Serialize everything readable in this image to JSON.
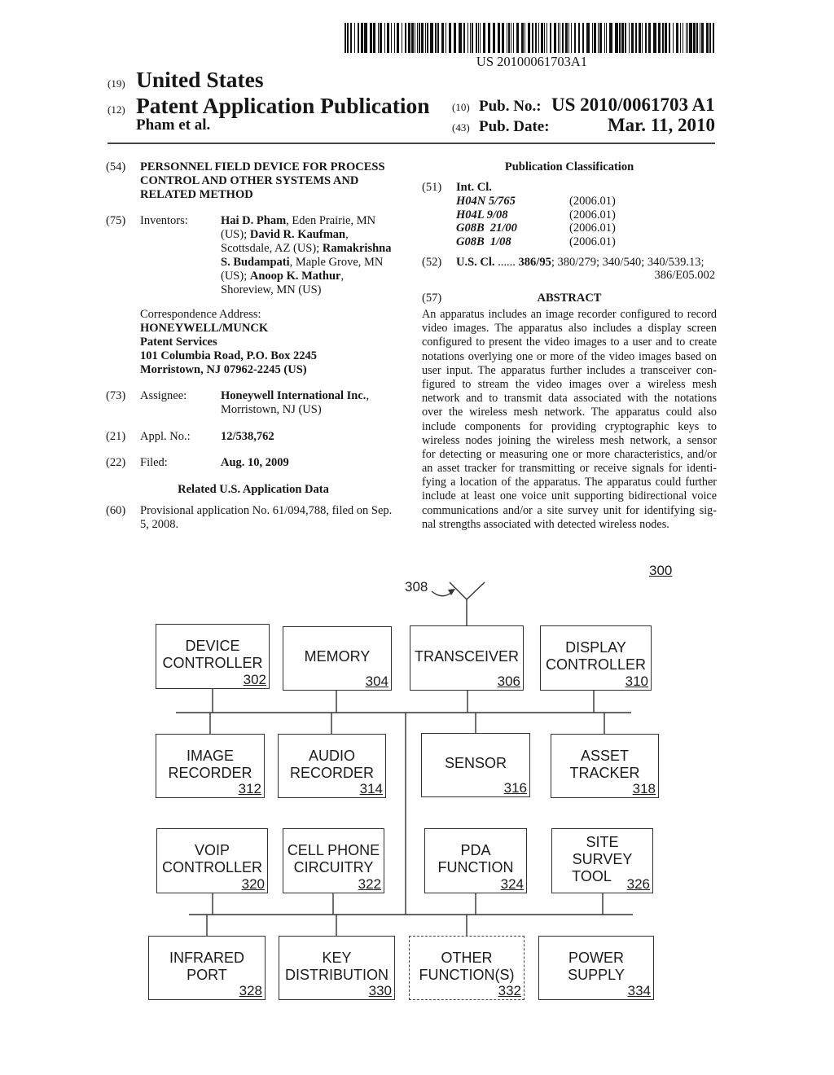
{
  "barcode": {
    "text": "US 20100061703A1"
  },
  "header": {
    "country_code": "(19)",
    "country": "United States",
    "type_code": "(12)",
    "type": "Patent Application Publication",
    "authors": "Pham et al.",
    "pub_no_code": "(10)",
    "pub_no_label": "Pub. No.:",
    "pub_no": "US 2010/0061703 A1",
    "pub_date_code": "(43)",
    "pub_date_label": "Pub. Date:",
    "pub_date": "Mar. 11, 2010"
  },
  "left": {
    "title": {
      "code": "(54)",
      "lines": [
        "PERSONNEL FIELD DEVICE FOR PROCESS",
        "CONTROL AND OTHER SYSTEMS AND",
        "RELATED METHOD"
      ]
    },
    "inventors": {
      "code": "(75)",
      "label": "Inventors:",
      "lines": [
        [
          {
            "text": "Hai D. Pham",
            "bold": true
          },
          {
            "text": ", Eden Prairie, MN"
          }
        ],
        [
          {
            "text": "(US); "
          },
          {
            "text": "David R. Kaufman",
            "bold": true
          },
          {
            "text": ","
          }
        ],
        [
          {
            "text": "Scottsdale, AZ (US); "
          },
          {
            "text": "Ramakrishna",
            "bold": true
          }
        ],
        [
          {
            "text": "S. Budampati",
            "bold": true
          },
          {
            "text": ", Maple Grove, MN"
          }
        ],
        [
          {
            "text": "(US); "
          },
          {
            "text": "Anoop K. Mathur",
            "bold": true
          },
          {
            "text": ","
          }
        ],
        [
          {
            "text": "Shoreview, MN (US)"
          }
        ]
      ]
    },
    "correspondence": {
      "label": "Correspondence Address:",
      "lines": [
        "HONEYWELL/MUNCK",
        "Patent Services",
        "101 Columbia Road, P.O. Box 2245",
        "Morristown, NJ 07962-2245 (US)"
      ]
    },
    "assignee": {
      "code": "(73)",
      "label": "Assignee:",
      "name": "Honeywell International Inc.",
      "name_suffix": ",",
      "location": "Morristown, NJ (US)"
    },
    "appl_no": {
      "code": "(21)",
      "label": "Appl. No.:",
      "value": "12/538,762"
    },
    "filed": {
      "code": "(22)",
      "label": "Filed:",
      "value": "Aug. 10, 2009"
    },
    "related_heading": "Related U.S. Application Data",
    "provisional": {
      "code": "(60)",
      "lines": [
        "Provisional application No. 61/094,788, filed on Sep.",
        "5, 2008."
      ]
    }
  },
  "right": {
    "classification_heading": "Publication Classification",
    "int_cl": {
      "code": "(51)",
      "label": "Int. Cl.",
      "entries": [
        {
          "class": "H04N 5/765",
          "version": "(2006.01)"
        },
        {
          "class": "H04L 9/08",
          "version": "(2006.01)"
        },
        {
          "class": "G08B  21/00",
          "version": "(2006.01)"
        },
        {
          "class": "G08B  1/08",
          "version": "(2006.01)"
        }
      ]
    },
    "us_cl": {
      "code": "(52)",
      "label": "U.S. Cl.",
      "dots": "......",
      "primary": "386/95",
      "rest": "; 380/279; 340/540; 340/539.13;",
      "continuation": "386/E05.002"
    },
    "abstract": {
      "code": "(57)",
      "heading": "ABSTRACT",
      "lines": [
        "An apparatus includes an image recorder configured to record",
        "video images. The apparatus also includes a display screen",
        "configured to present the video images to a user and to create",
        "notations overlying one or more of the video images based on",
        "user input. The apparatus further includes a transceiver con-",
        "figured to stream the video images over a wireless mesh",
        "network and to transmit data associated with the notations",
        "over the wireless mesh network. The apparatus could also",
        "include components for providing cryptographic keys to",
        "wireless nodes joining the wireless mesh network, a sensor",
        "for detecting or measuring one or more characteristics, and/or",
        "an asset tracker for transmitting or receive signals for identi-",
        "fying a location of the apparatus. The apparatus could further",
        "include at least one voice unit supporting bidirectional voice",
        "communications and/or a site survey unit for identifying sig-",
        "nal strengths associated with detected wireless nodes."
      ]
    }
  },
  "figure": {
    "ref": "300",
    "antenna": {
      "ref": "308"
    },
    "components": [
      {
        "ref": "302",
        "label": [
          "DEVICE",
          "CONTROLLER"
        ]
      },
      {
        "ref": "304",
        "label": [
          "MEMORY"
        ]
      },
      {
        "ref": "306",
        "label": [
          "TRANSCEIVER"
        ]
      },
      {
        "ref": "310",
        "label": [
          "DISPLAY",
          "CONTROLLER"
        ]
      },
      {
        "ref": "312",
        "label": [
          "IMAGE",
          "RECORDER"
        ]
      },
      {
        "ref": "314",
        "label": [
          "AUDIO",
          "RECORDER"
        ]
      },
      {
        "ref": "316",
        "label": [
          "SENSOR"
        ]
      },
      {
        "ref": "318",
        "label": [
          "ASSET",
          "TRACKER"
        ]
      },
      {
        "ref": "320",
        "label": [
          "VOIP",
          "CONTROLLER"
        ]
      },
      {
        "ref": "322",
        "label": [
          "CELL PHONE",
          "CIRCUITRY"
        ]
      },
      {
        "ref": "324",
        "label": [
          "PDA",
          "FUNCTION"
        ]
      },
      {
        "ref": "326",
        "label": [
          "SITE",
          "SURVEY",
          "TOOL"
        ]
      },
      {
        "ref": "328",
        "label": [
          "INFRARED",
          "PORT"
        ]
      },
      {
        "ref": "330",
        "label": [
          "KEY",
          "DISTRIBUTION"
        ]
      },
      {
        "ref": "332",
        "label": [
          "OTHER",
          "FUNCTION(S)"
        ],
        "optional": true
      },
      {
        "ref": "334",
        "label": [
          "POWER",
          "SUPPLY"
        ]
      }
    ]
  }
}
